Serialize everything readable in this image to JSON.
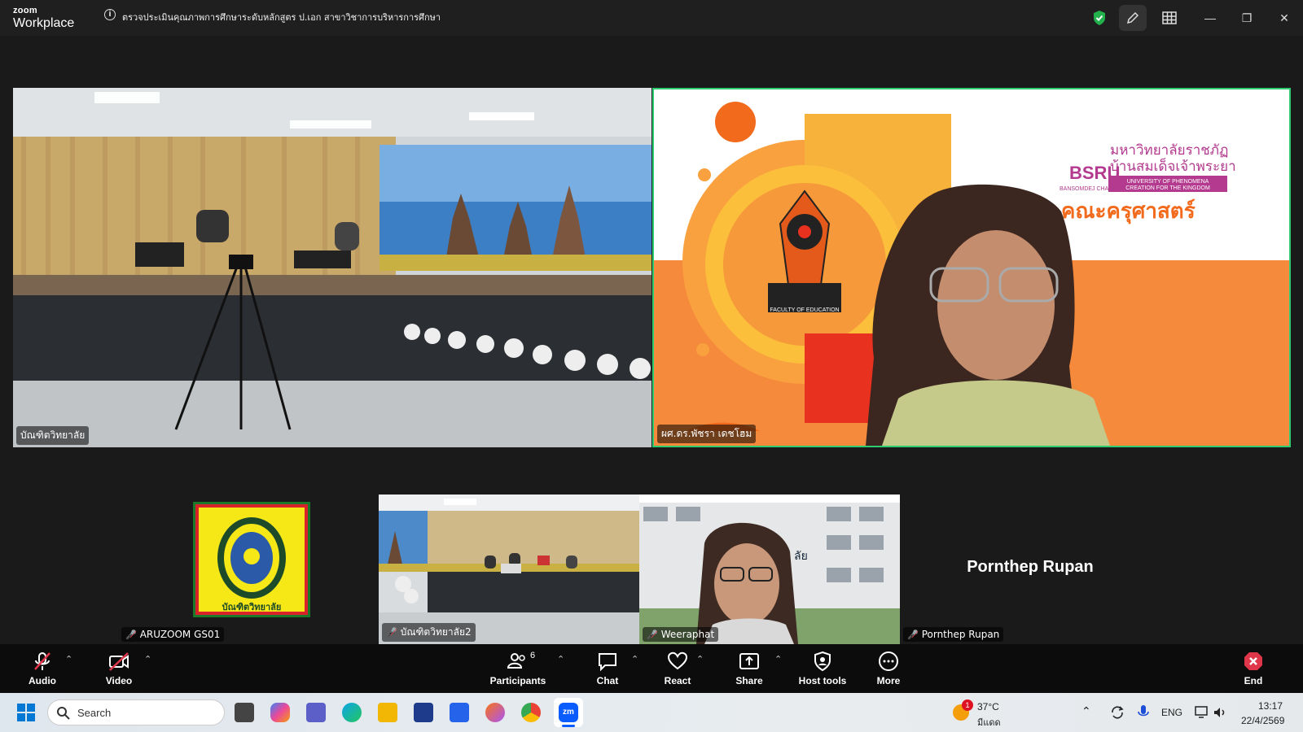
{
  "window": {
    "brand_top": "zoom",
    "brand_bottom": "Workplace",
    "meeting_title": "ตรวจประเมินคุณภาพการศึกษาระดับหลักสูตร ป.เอก สาขาวิชาการบริหารการศึกษา"
  },
  "participants": {
    "top_left": {
      "name": "บัณฑิตวิทยาลัย"
    },
    "top_right": {
      "name": "ผศ.ดร.พัชรา เดชโฮม",
      "slide_title_th": "มหาวิทยาลัยราชภัฏ",
      "slide_title_th2": "บ้านสมเด็จเจ้าพระยา",
      "slide_brand": "BSRU",
      "slide_brand_sub": "BANSOMDEJ CHAOPRAYA",
      "slide_tag1": "UNIVERSITY OF PHENOMENA",
      "slide_tag2": "CREATION FOR THE KINGDOM",
      "slide_faculty": "คณะครุศาสตร์",
      "slide_logo_caption": "FACULTY OF EDUCATION"
    },
    "bottom": [
      {
        "name": "ARUZOOM GS01"
      },
      {
        "name": "บัณฑิตวิทยาลัย2"
      },
      {
        "name": "Weeraphat"
      },
      {
        "name": "Pornthep Rupan",
        "display": "Pornthep Rupan"
      }
    ]
  },
  "toolbar": {
    "audio": "Audio",
    "video": "Video",
    "participants": "Participants",
    "participants_count": "6",
    "chat": "Chat",
    "react": "React",
    "share": "Share",
    "host_tools": "Host tools",
    "more": "More",
    "end": "End"
  },
  "taskbar": {
    "search_placeholder": "Search",
    "weather_temp": "37°C",
    "weather_desc": "มีแดด",
    "weather_badge": "1",
    "lang": "ENG",
    "time": "13:17",
    "date": "22/4/2569"
  }
}
